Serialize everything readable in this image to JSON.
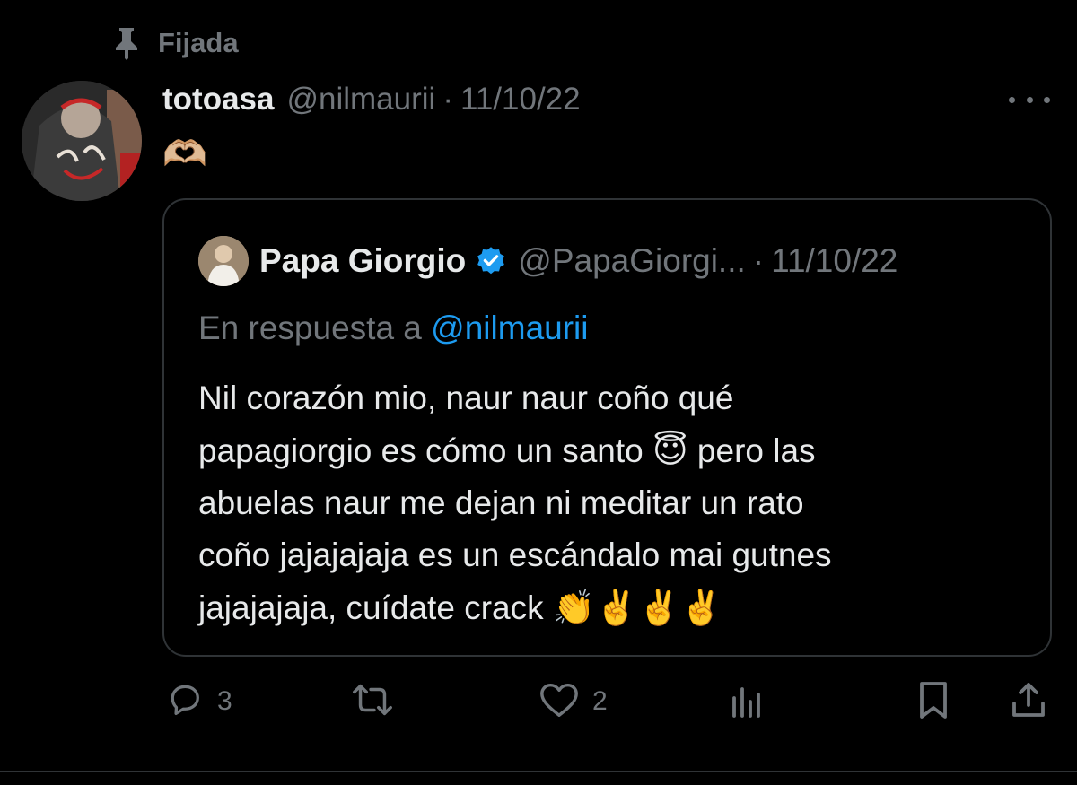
{
  "pinned": {
    "label": "Fijada",
    "icon": "pin-icon"
  },
  "tweet": {
    "display_name": "totoasa",
    "handle": "@nilmaurii",
    "separator": "·",
    "date": "11/10/22",
    "text": "🫶🏼",
    "more_icon": "more-icon"
  },
  "quote": {
    "display_name": "Papa Giorgio",
    "verified_icon": "verified-badge-icon",
    "handle": "@PapaGiorgi...",
    "separator": "·",
    "date": "11/10/22",
    "reply_prefix": "En respuesta a",
    "reply_mention": "@nilmaurii",
    "body_lines": [
      "Nil corazón mio, naur naur coño qué",
      "papagiorgio es cómo un santo",
      "pero las",
      "abuelas naur me dejan ni meditar un rato",
      "coño jajajajaja es un escándalo mai gutnes",
      "jajajajaja, cuídate crack"
    ],
    "emoji_halo": "😇",
    "emoji_end": "👏✌️✌️✌️"
  },
  "actions": {
    "reply_count": "3",
    "like_count": "2"
  },
  "colors": {
    "background": "#000000",
    "text_primary": "#e7e9ea",
    "text_secondary": "#71767b",
    "accent": "#1d9bf0",
    "border": "#2f3336"
  }
}
